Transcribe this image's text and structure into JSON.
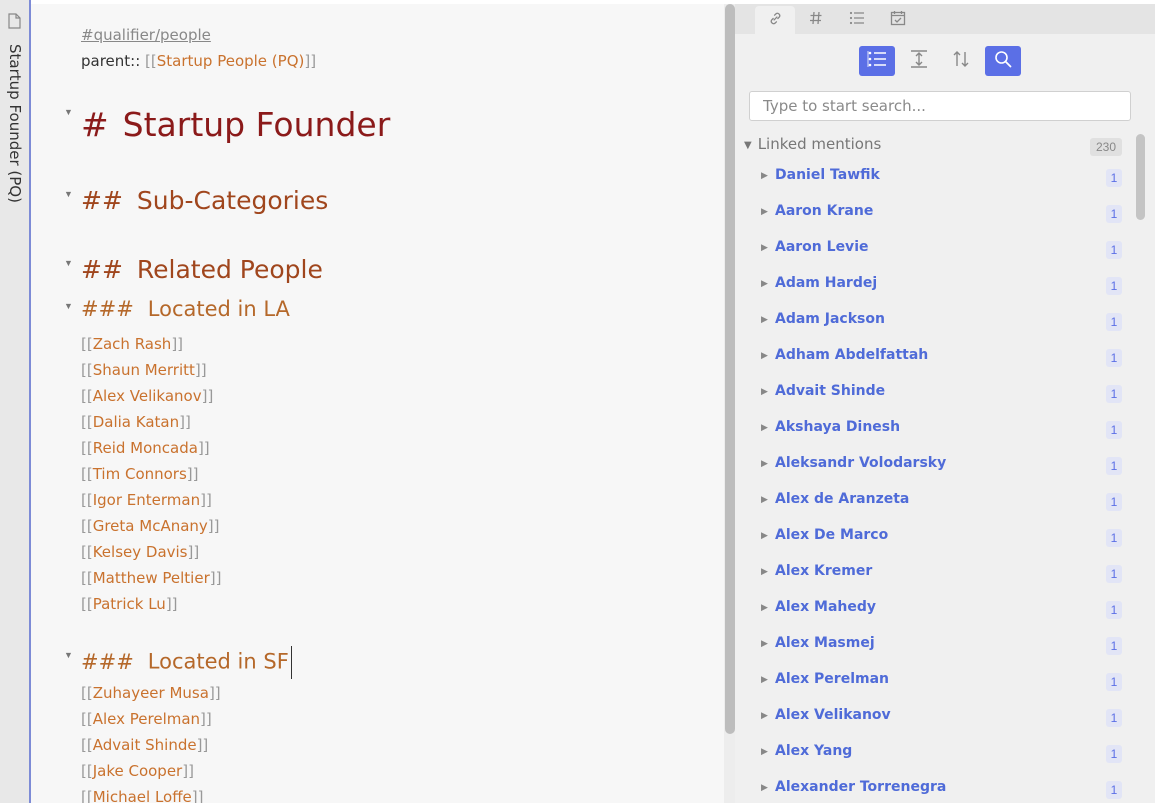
{
  "page_tab": {
    "title": "Startup Founder (PQ)",
    "icon": "document-icon"
  },
  "editor": {
    "tag": "#qualifier/people",
    "parent_key": "parent:: ",
    "parent_open": "[[",
    "parent_link": "Startup People (PQ)",
    "parent_close": "]]",
    "h1_marker": "#",
    "h1_text": "Startup Founder",
    "h2_marker": "##",
    "h2a_text": "Sub-Categories",
    "h2b_text": "Related People",
    "h3_marker": "###",
    "h3a_text": "Located in LA",
    "h3b_text": "Located in SF",
    "link_open": "[[",
    "link_close": "]]",
    "la_people": [
      "Zach Rash",
      "Shaun Merritt",
      "Alex Velikanov",
      "Dalia Katan",
      "Reid Moncada",
      "Tim Connors",
      "Igor Enterman",
      "Greta McAnany",
      "Kelsey Davis",
      "Matthew Peltier",
      "Patrick Lu"
    ],
    "sf_people": [
      "Zuhayeer Musa",
      "Alex Perelman",
      "Advait Shinde",
      "Jake Cooper",
      "Michael Loffe"
    ]
  },
  "sidebar": {
    "tabs": [
      "link-icon",
      "hash-icon",
      "list-icon",
      "calendar-check-icon"
    ],
    "toolbar": [
      "bullet-list-icon",
      "expand-vertical-icon",
      "sort-icon",
      "search-icon"
    ],
    "search_placeholder": "Type to start search...",
    "linked_mentions_label": "Linked mentions",
    "linked_mentions_count": "230",
    "mentions": [
      {
        "name": "Daniel Tawfik",
        "count": "1"
      },
      {
        "name": "Aaron Krane",
        "count": "1"
      },
      {
        "name": "Aaron Levie",
        "count": "1"
      },
      {
        "name": "Adam Hardej",
        "count": "1"
      },
      {
        "name": "Adam Jackson",
        "count": "1"
      },
      {
        "name": "Adham Abdelfattah",
        "count": "1"
      },
      {
        "name": "Advait Shinde",
        "count": "1"
      },
      {
        "name": "Akshaya Dinesh",
        "count": "1"
      },
      {
        "name": "Aleksandr Volodarsky",
        "count": "1"
      },
      {
        "name": "Alex de Aranzeta",
        "count": "1"
      },
      {
        "name": "Alex De Marco",
        "count": "1"
      },
      {
        "name": "Alex Kremer",
        "count": "1"
      },
      {
        "name": "Alex Mahedy",
        "count": "1"
      },
      {
        "name": "Alex Masmej",
        "count": "1"
      },
      {
        "name": "Alex Perelman",
        "count": "1"
      },
      {
        "name": "Alex Velikanov",
        "count": "1"
      },
      {
        "name": "Alex Yang",
        "count": "1"
      },
      {
        "name": "Alexander Torrenegra",
        "count": "1"
      }
    ]
  },
  "colors": {
    "accent": "#5b6fe6",
    "mention_link": "#4f6bd8",
    "h1": "#8b1a1a",
    "h2": "#a0461d",
    "h3": "#b5682a",
    "page_link": "#c9722e"
  }
}
